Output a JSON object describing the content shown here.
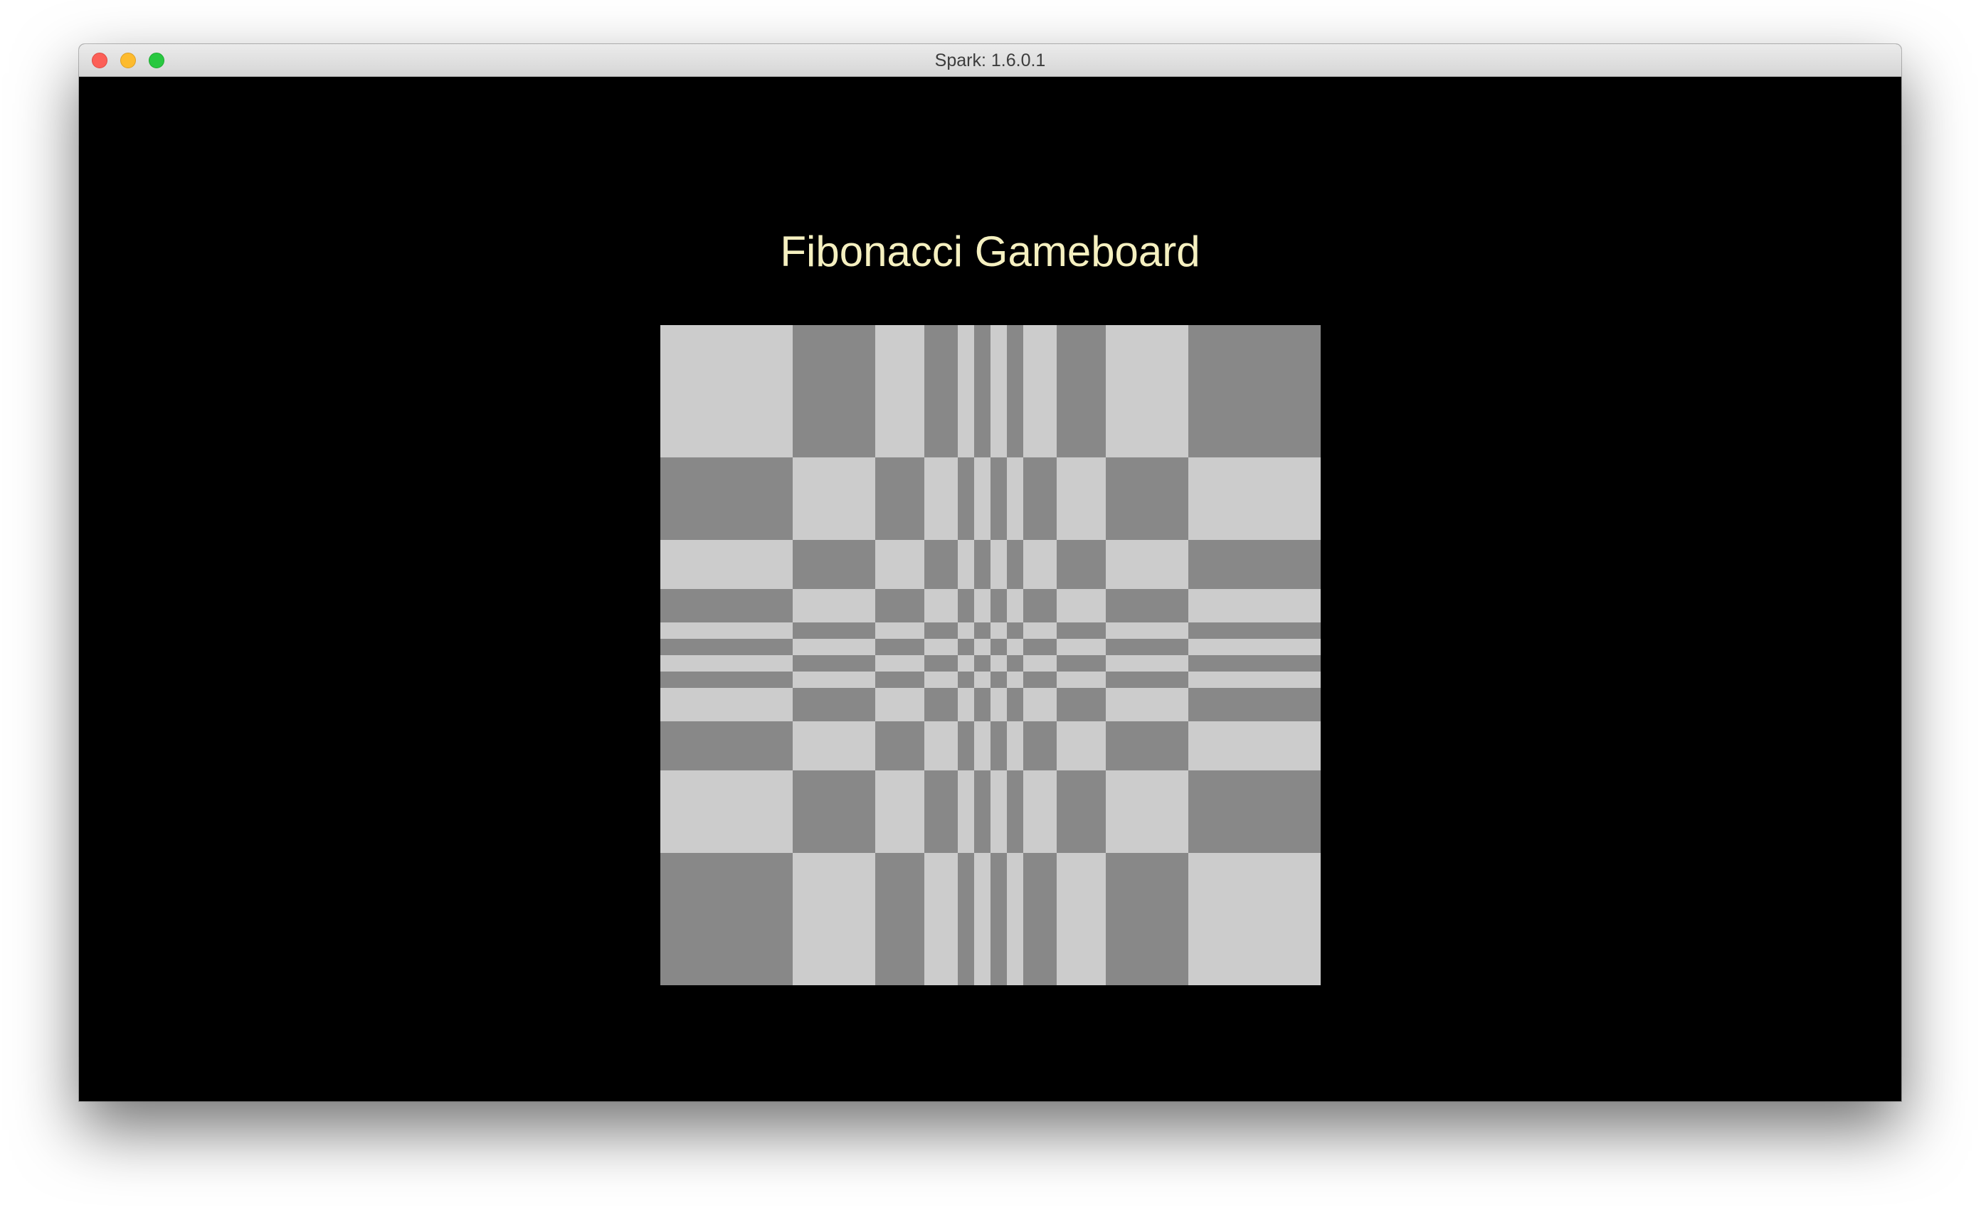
{
  "window": {
    "title": "Spark: 1.6.0.1"
  },
  "main": {
    "heading": "Fibonacci Gameboard"
  },
  "board": {
    "fibonacci_sequence": [
      1,
      1,
      2,
      3,
      5,
      8
    ],
    "colors": {
      "light": "#cccccc",
      "dark": "#888888",
      "background": "#000000",
      "heading": "#f5f0c0"
    }
  }
}
